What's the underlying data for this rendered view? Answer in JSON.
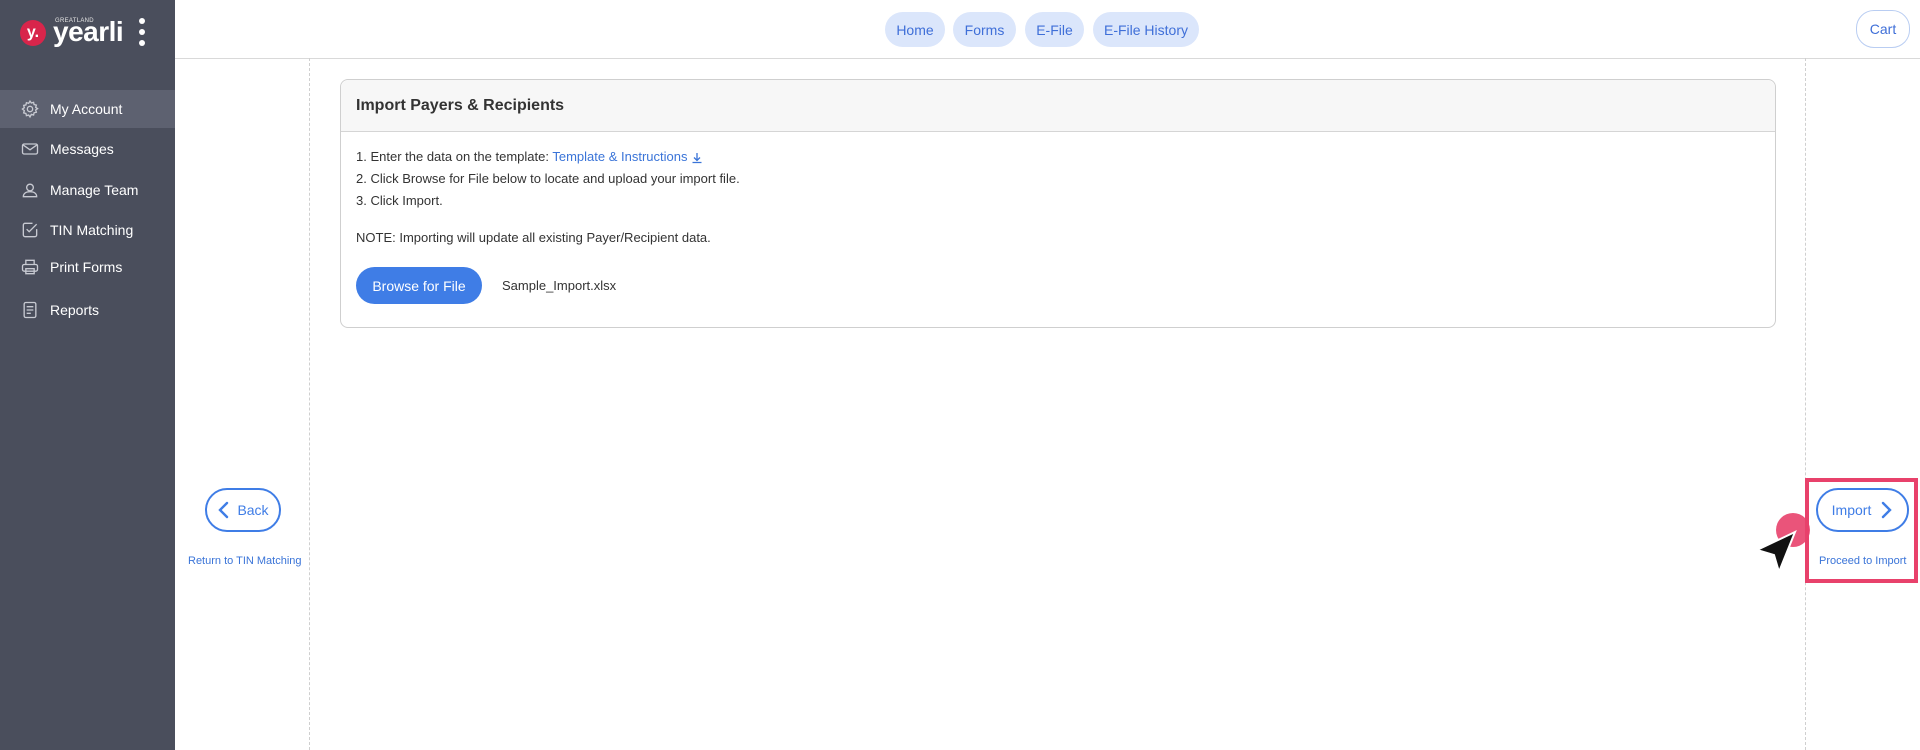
{
  "brand": {
    "badge": "y.",
    "small": "GREATLAND",
    "name": "yearli"
  },
  "sidebar": {
    "items": [
      {
        "label": "My Account",
        "icon": "gear-icon",
        "active": true
      },
      {
        "label": "Messages",
        "icon": "envelope-icon",
        "active": false
      },
      {
        "label": "Manage Team",
        "icon": "user-icon",
        "active": false
      },
      {
        "label": "TIN Matching",
        "icon": "check-square-icon",
        "active": false
      },
      {
        "label": "Print Forms",
        "icon": "printer-icon",
        "active": false
      },
      {
        "label": "Reports",
        "icon": "document-icon",
        "active": false
      }
    ]
  },
  "topnav": {
    "tabs": [
      "Home",
      "Forms",
      "E-File",
      "E-File History"
    ],
    "cart": "Cart"
  },
  "card": {
    "title": "Import Payers & Recipients",
    "step1_prefix": "1. Enter the data on the template: ",
    "step1_link": "Template & Instructions",
    "step2": "2. Click Browse for File below to locate and upload your import file.",
    "step3": "3. Click Import.",
    "note": "NOTE: Importing will update all existing Payer/Recipient data.",
    "browse_label": "Browse for File",
    "file_name": "Sample_Import.xlsx"
  },
  "back": {
    "label": "Back",
    "sub": "Return to TIN Matching"
  },
  "import": {
    "label": "Import",
    "sub": "Proceed to Import"
  },
  "colors": {
    "accent": "#3f7de6",
    "sidebar": "#4a4e5c",
    "highlight": "#e8416b",
    "pill": "#dbe6fb"
  }
}
